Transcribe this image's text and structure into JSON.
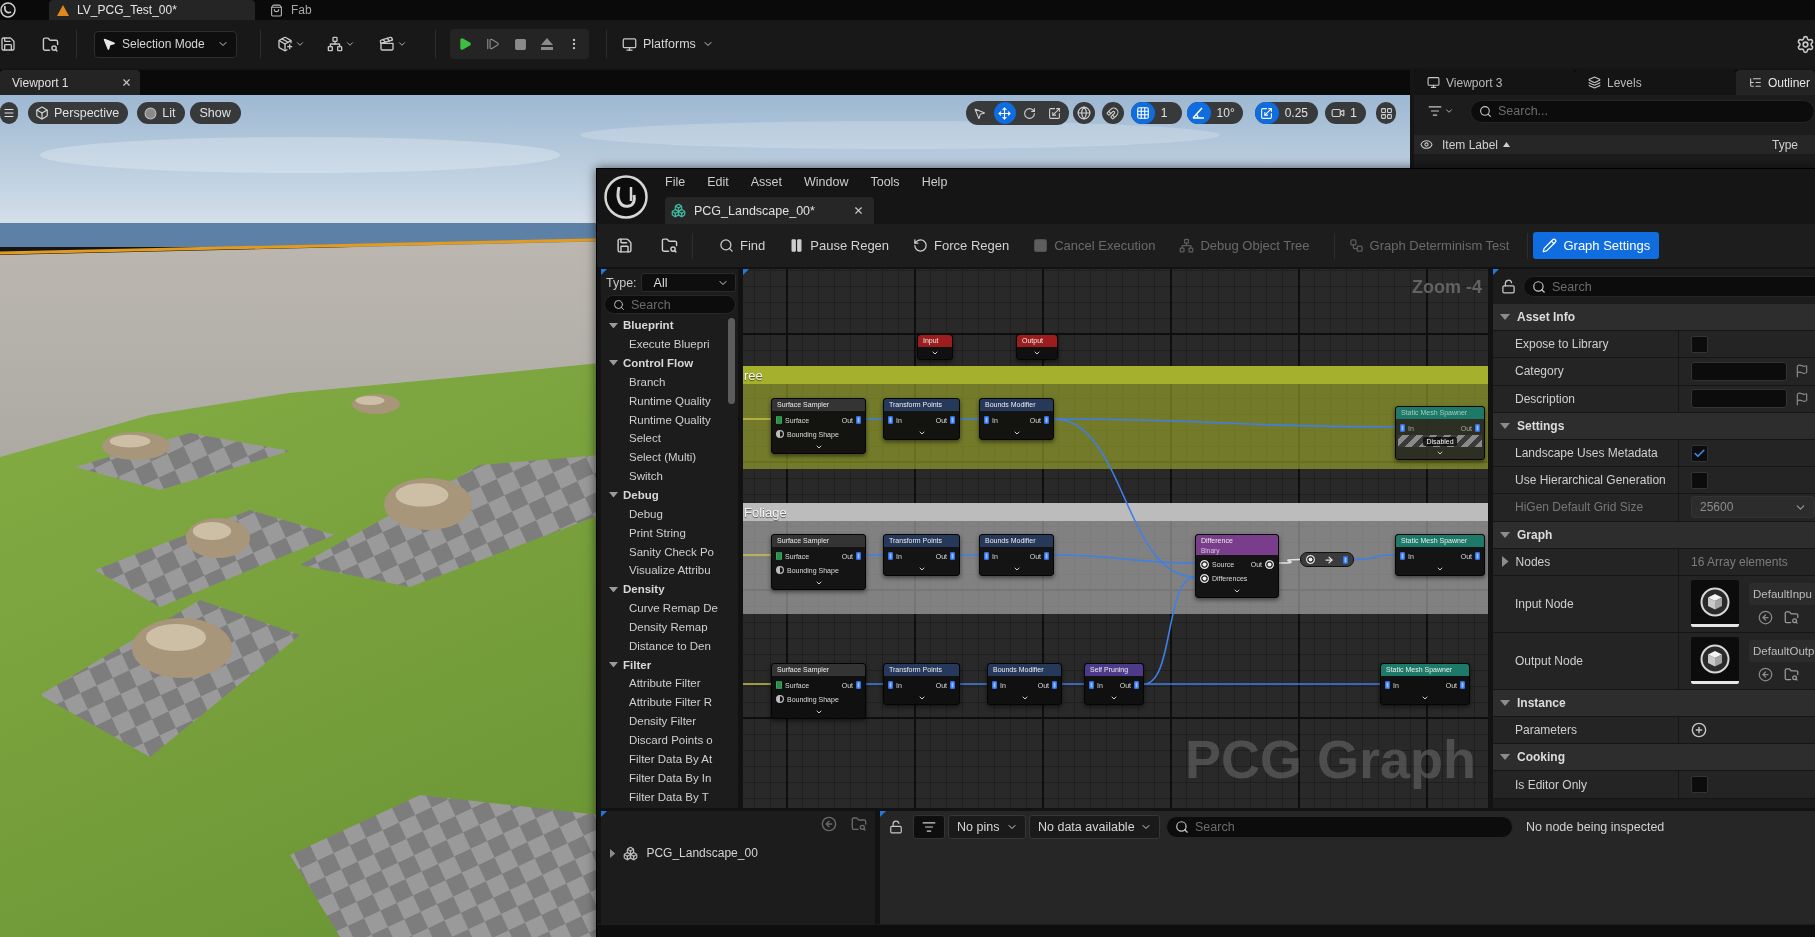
{
  "editor_tabs": [
    {
      "label": "LV_PCG_Test_00*",
      "kind": "level",
      "selected": true
    },
    {
      "label": "Fab",
      "kind": "store",
      "selected": false
    }
  ],
  "main_toolbar": {
    "mode": "Selection Mode",
    "platforms": "Platforms"
  },
  "viewport": {
    "tab": "Viewport 1",
    "view": "Perspective",
    "lighting": "Lit",
    "show": "Show",
    "transform_tools": [
      {
        "kind": "select",
        "selected": false
      },
      {
        "kind": "move",
        "selected": true
      },
      {
        "kind": "rotate",
        "selected": false
      },
      {
        "kind": "scale",
        "selected": false
      }
    ],
    "snaps": [
      {
        "kind": "grid",
        "value": "1",
        "on": true
      },
      {
        "kind": "rotation",
        "value": "10°",
        "on": true
      },
      {
        "kind": "scale",
        "value": "0.25",
        "on": true
      }
    ],
    "camera_speed": "1"
  },
  "side_panel": {
    "tabs": [
      {
        "label": "Viewport 3",
        "kind": "viewport",
        "selected": false
      },
      {
        "label": "Levels",
        "kind": "levels",
        "selected": false
      },
      {
        "label": "Outliner",
        "kind": "outliner",
        "selected": true
      }
    ],
    "search": {
      "placeholder": "Search..."
    },
    "columns": [
      {
        "label": "Item Label",
        "sorted": true
      },
      {
        "label": "Type",
        "sorted": false
      }
    ]
  },
  "pcg_editor": {
    "menu": [
      "File",
      "Edit",
      "Asset",
      "Window",
      "Tools",
      "Help"
    ],
    "tab": {
      "label": "PCG_Landscape_00*"
    },
    "toolbar": [
      {
        "kind": "save",
        "disabled": false,
        "on": false
      },
      {
        "kind": "browse",
        "disabled": false,
        "on": false
      },
      {
        "kind": "find",
        "label": "Find",
        "disabled": false,
        "on": false
      },
      {
        "kind": "pause",
        "label": "Pause Regen",
        "disabled": false,
        "on": false
      },
      {
        "kind": "regen",
        "label": "Force Regen",
        "disabled": false,
        "on": false
      },
      {
        "kind": "cancel",
        "label": "Cancel Execution",
        "disabled": true,
        "on": false
      },
      {
        "kind": "tree",
        "label": "Debug Object Tree",
        "disabled": true,
        "on": false
      },
      {
        "kind": "determinism",
        "label": "Graph Determinism Test",
        "disabled": true,
        "on": false
      },
      {
        "kind": "settings",
        "label": "Graph Settings",
        "disabled": false,
        "on": true
      }
    ],
    "palette": {
      "type_label": "Type:",
      "type_value": "All",
      "search": {
        "placeholder": "Search"
      },
      "categories": [
        {
          "label": "Blueprint",
          "expanded": true,
          "children": [
            {
              "label": "Execute Bluepri"
            }
          ]
        },
        {
          "label": "Control Flow",
          "expanded": true,
          "children": [
            {
              "label": "Branch"
            },
            {
              "label": "Runtime Quality"
            },
            {
              "label": "Runtime Quality"
            },
            {
              "label": "Select"
            },
            {
              "label": "Select (Multi)"
            },
            {
              "label": "Switch"
            }
          ]
        },
        {
          "label": "Debug",
          "expanded": true,
          "children": [
            {
              "label": "Debug"
            },
            {
              "label": "Print String"
            },
            {
              "label": "Sanity Check Po"
            },
            {
              "label": "Visualize Attribu"
            }
          ]
        },
        {
          "label": "Density",
          "expanded": true,
          "children": [
            {
              "label": "Curve Remap De"
            },
            {
              "label": "Density Remap"
            },
            {
              "label": "Distance to Den"
            }
          ]
        },
        {
          "label": "Filter",
          "expanded": true,
          "children": [
            {
              "label": "Attribute Filter"
            },
            {
              "label": "Attribute Filter R"
            },
            {
              "label": "Density Filter"
            },
            {
              "label": "Discard Points o"
            },
            {
              "label": "Filter Data By At"
            },
            {
              "label": "Filter Data By In"
            },
            {
              "label": "Filter Data By T"
            }
          ]
        }
      ]
    },
    "graph": {
      "zoom_label": "Zoom -4",
      "graph_label": "PCG Graph",
      "comments": [
        {
          "title": "ree",
          "color": "#a5b12c"
        },
        {
          "title": "Foliage",
          "color": "#bcbcbc"
        }
      ],
      "nodes": [
        {
          "kind": "io",
          "title": "Input",
          "color": "#9c1d1d",
          "disabled": false
        },
        {
          "kind": "io",
          "title": "Output",
          "color": "#9c1d1d",
          "disabled": false
        },
        {
          "kind": "node",
          "title": "Surface Sampler",
          "color": "#343434",
          "disabled": false,
          "inputs": [
            {
              "label": "Surface",
              "kind": "surface"
            },
            {
              "label": "Bounding Shape",
              "kind": "spatial"
            }
          ],
          "outputs": [
            {
              "label": "Out",
              "kind": "points"
            }
          ]
        },
        {
          "kind": "node",
          "title": "Transform Points",
          "color": "#27395b",
          "disabled": false,
          "inputs": [
            {
              "label": "In",
              "kind": "points"
            }
          ],
          "outputs": [
            {
              "label": "Out",
              "kind": "points"
            }
          ]
        },
        {
          "kind": "node",
          "title": "Bounds Modifier",
          "color": "#27395b",
          "disabled": false,
          "inputs": [
            {
              "label": "In",
              "kind": "points"
            }
          ],
          "outputs": [
            {
              "label": "Out",
              "kind": "points"
            }
          ]
        },
        {
          "kind": "node",
          "title": "Static Mesh Spawner",
          "color": "#1d7a68",
          "disabled": true,
          "status": "Disabled",
          "inputs": [
            {
              "label": "In",
              "kind": "points"
            }
          ],
          "outputs": [
            {
              "label": "Out",
              "kind": "points"
            }
          ]
        },
        {
          "kind": "node",
          "title": "Surface Sampler",
          "color": "#343434",
          "disabled": false,
          "inputs": [
            {
              "label": "Surface",
              "kind": "surface"
            },
            {
              "label": "Bounding Shape",
              "kind": "spatial"
            }
          ],
          "outputs": [
            {
              "label": "Out",
              "kind": "points"
            }
          ]
        },
        {
          "kind": "node",
          "title": "Transform Points",
          "color": "#27395b",
          "disabled": false,
          "inputs": [
            {
              "label": "In",
              "kind": "points"
            }
          ],
          "outputs": [
            {
              "label": "Out",
              "kind": "points"
            }
          ]
        },
        {
          "kind": "node",
          "title": "Bounds Modifier",
          "color": "#27395b",
          "disabled": false,
          "inputs": [
            {
              "label": "In",
              "kind": "points"
            }
          ],
          "outputs": [
            {
              "label": "Out",
              "kind": "points"
            }
          ]
        },
        {
          "kind": "node",
          "title": "Difference",
          "subtitle": "Binary",
          "color": "#7a3d8c",
          "disabled": false,
          "inputs": [
            {
              "label": "Source",
              "kind": "any"
            },
            {
              "label": "Differences",
              "kind": "any"
            }
          ],
          "outputs": [
            {
              "label": "Out",
              "kind": "any"
            }
          ]
        },
        {
          "kind": "convert",
          "disabled": false,
          "inputs": [
            {
              "kind": "any"
            }
          ],
          "outputs": [
            {
              "kind": "points"
            }
          ]
        },
        {
          "kind": "node",
          "title": "Static Mesh Spawner",
          "color": "#1d7a68",
          "disabled": false,
          "inputs": [
            {
              "label": "In",
              "kind": "points"
            }
          ],
          "outputs": [
            {
              "label": "Out",
              "kind": "points"
            }
          ]
        },
        {
          "kind": "node",
          "title": "Surface Sampler",
          "color": "#343434",
          "disabled": false,
          "inputs": [
            {
              "label": "Surface",
              "kind": "surface"
            },
            {
              "label": "Bounding Shape",
              "kind": "spatial"
            }
          ],
          "outputs": [
            {
              "label": "Out",
              "kind": "points"
            }
          ]
        },
        {
          "kind": "node",
          "title": "Transform Points",
          "color": "#27395b",
          "disabled": false,
          "inputs": [
            {
              "label": "In",
              "kind": "points"
            }
          ],
          "outputs": [
            {
              "label": "Out",
              "kind": "points"
            }
          ]
        },
        {
          "kind": "node",
          "title": "Bounds Modifier",
          "color": "#27395b",
          "disabled": false,
          "inputs": [
            {
              "label": "In",
              "kind": "points"
            }
          ],
          "outputs": [
            {
              "label": "Out",
              "kind": "points"
            }
          ]
        },
        {
          "kind": "node",
          "title": "Self Pruning",
          "color": "#4d3a88",
          "disabled": false,
          "inputs": [
            {
              "label": "In",
              "kind": "points"
            }
          ],
          "outputs": [
            {
              "label": "Out",
              "kind": "points"
            }
          ]
        },
        {
          "kind": "node",
          "title": "Static Mesh Spawner",
          "color": "#1d7a68",
          "disabled": false,
          "inputs": [
            {
              "label": "In",
              "kind": "points"
            }
          ],
          "outputs": [
            {
              "label": "Out",
              "kind": "points"
            }
          ]
        }
      ]
    },
    "details": {
      "search": {
        "placeholder": "Search"
      },
      "sections": [
        {
          "title": "Asset Info",
          "expanded": true,
          "rows": [
            {
              "label": "Expose to Library",
              "kind": "checkbox",
              "checked": false,
              "disabled": false
            },
            {
              "label": "Category",
              "kind": "text",
              "disabled": false
            },
            {
              "label": "Description",
              "kind": "text",
              "disabled": false
            }
          ]
        },
        {
          "title": "Settings",
          "expanded": true,
          "rows": [
            {
              "label": "Landscape Uses Metadata",
              "kind": "checkbox",
              "checked": true,
              "disabled": false
            },
            {
              "label": "Use Hierarchical Generation",
              "kind": "checkbox",
              "checked": false,
              "disabled": false
            },
            {
              "label": "HiGen Default Grid Size",
              "kind": "dropdown",
              "value": "25600",
              "disabled": true
            }
          ]
        },
        {
          "title": "Graph",
          "expanded": true,
          "rows": [
            {
              "label": "Nodes",
              "kind": "array",
              "expanded": false,
              "value": "16 Array elements",
              "disabled": false
            },
            {
              "label": "Input Node",
              "kind": "asset",
              "value": "DefaultInpu",
              "disabled": false
            },
            {
              "label": "Output Node",
              "kind": "asset",
              "value": "DefaultOutp",
              "disabled": false
            }
          ]
        },
        {
          "title": "Instance",
          "expanded": true,
          "rows": [
            {
              "label": "Parameters",
              "kind": "add",
              "disabled": false
            }
          ]
        },
        {
          "title": "Cooking",
          "expanded": true,
          "rows": [
            {
              "label": "Is Editor Only",
              "kind": "checkbox",
              "checked": false,
              "disabled": false
            }
          ]
        }
      ]
    },
    "bottom": {
      "tree": [
        {
          "label": "PCG_Landscape_00",
          "expanded": false
        }
      ],
      "inspector": {
        "pins": "No pins",
        "data": "No data available",
        "search": {
          "placeholder": "Search"
        },
        "message": "No node being inspected"
      }
    }
  }
}
